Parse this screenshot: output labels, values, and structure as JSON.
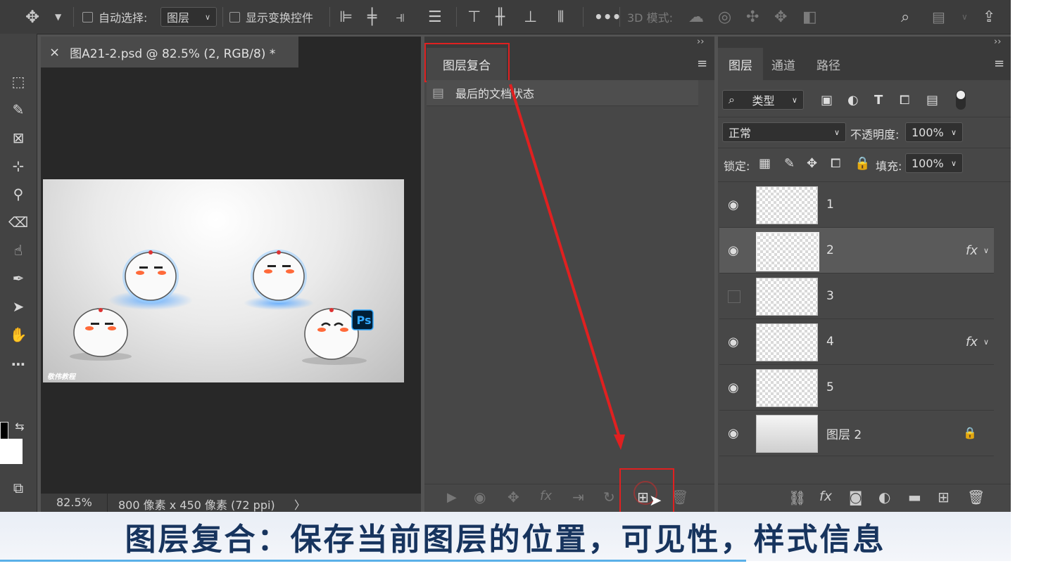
{
  "options_bar": {
    "auto_select_label": "自动选择:",
    "auto_select_value": "图层",
    "show_transform_label": "显示变换控件",
    "more": "•••",
    "mode_3d_label": "3D 模式:"
  },
  "document": {
    "tab_title": "图A21-2.psd @ 82.5% (2, RGB/8) *",
    "close": "×",
    "zoom": "82.5%",
    "dimensions": "800 像素 x 450 像素 (72 ppi)",
    "arrow": "〉",
    "watermark": "敬伟教程",
    "ps_badge": "Ps"
  },
  "layer_comps": {
    "tab_label": "图层复合",
    "item_label": "最后的文档状态"
  },
  "layers_panel": {
    "tabs": [
      "图层",
      "通道",
      "路径"
    ],
    "filter_label": "类型",
    "blend_mode": "正常",
    "opacity_label": "不透明度:",
    "opacity_value": "100%",
    "lock_label": "锁定:",
    "fill_label": "填充:",
    "fill_value": "100%",
    "fx_label": "fx",
    "layers": [
      {
        "name": "1",
        "visible": true,
        "fx": false
      },
      {
        "name": "2",
        "visible": true,
        "fx": true
      },
      {
        "name": "3",
        "visible": false,
        "fx": false
      },
      {
        "name": "4",
        "visible": true,
        "fx": true
      },
      {
        "name": "5",
        "visible": true,
        "fx": false
      },
      {
        "name": "图层 2",
        "visible": true,
        "fx": false
      }
    ]
  },
  "caption": "图层复合：保存当前图层的位置，可见性，样式信息",
  "colors": {
    "highlight": "#e02020",
    "caption_text": "#17345e"
  }
}
